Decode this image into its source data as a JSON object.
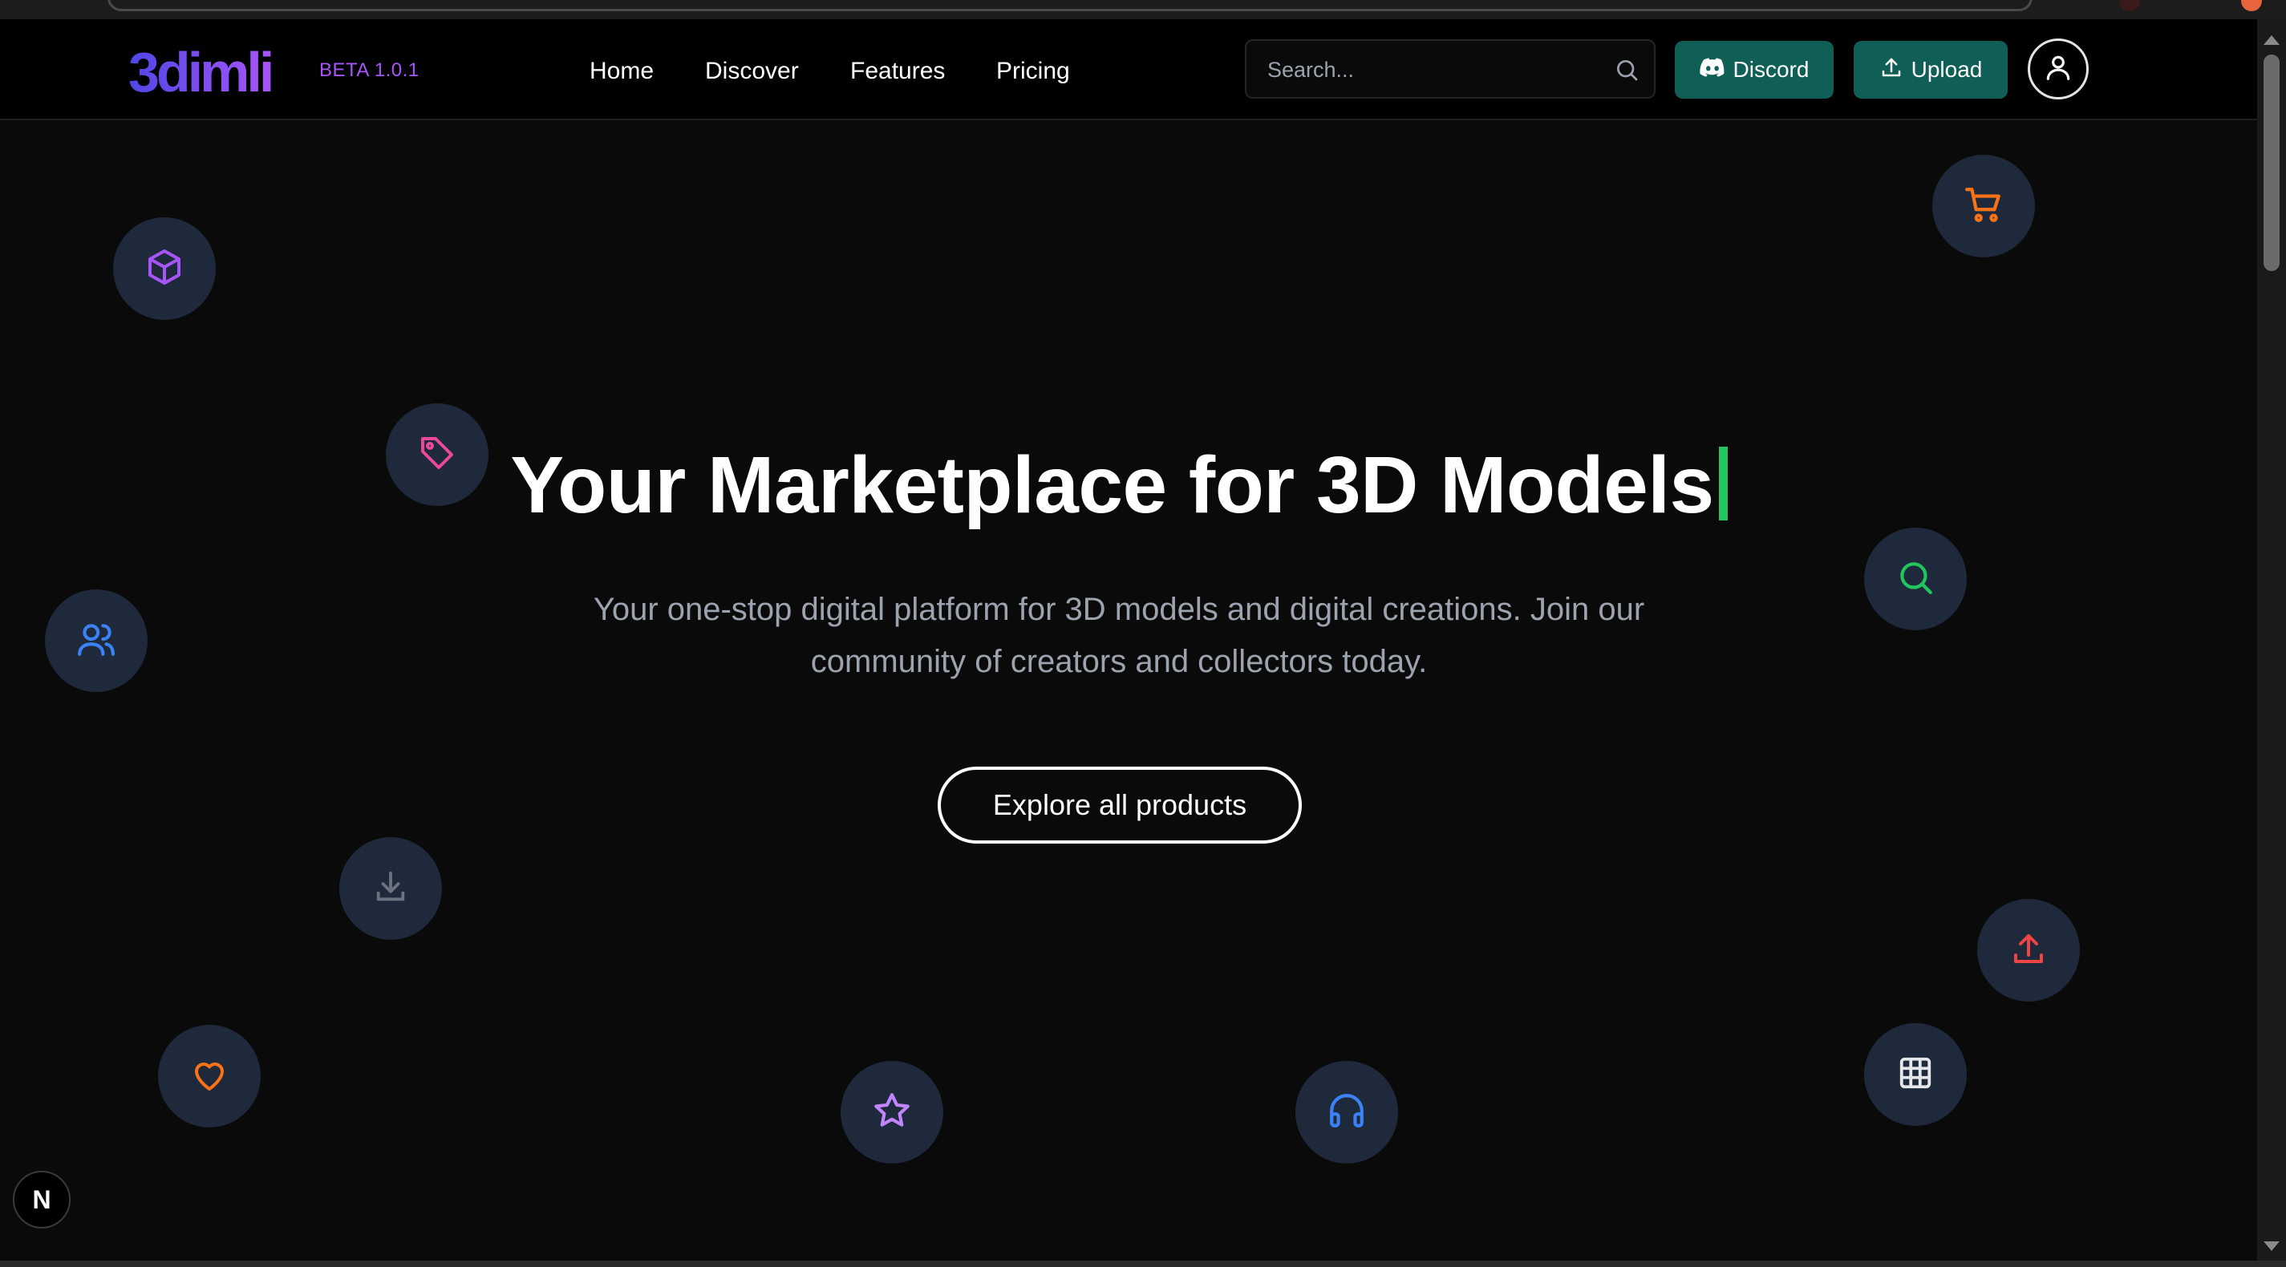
{
  "brand": {
    "logo_text": "3dimli",
    "version_badge": "BETA 1.0.1",
    "accent": "#7c3aed"
  },
  "nav": {
    "links": [
      "Home",
      "Discover",
      "Features",
      "Pricing"
    ]
  },
  "search": {
    "placeholder": "Search..."
  },
  "actions": {
    "discord_label": "Discord",
    "upload_label": "Upload",
    "button_color": "#0f5f57"
  },
  "hero": {
    "title": "Your Marketplace for 3D Models",
    "subtitle_line1": "Your one-stop digital platform for 3D models and digital creations. Join our",
    "subtitle_line2": "community of creators and collectors today.",
    "cta_label": "Explore all products",
    "cursor_color": "#22c55e"
  },
  "floating_icons": [
    {
      "icon": "cube-icon",
      "color": "#a855f7"
    },
    {
      "icon": "tag-icon",
      "color": "#ec4899"
    },
    {
      "icon": "users-icon",
      "color": "#3b82f6"
    },
    {
      "icon": "download-icon",
      "color": "#6b7280"
    },
    {
      "icon": "heart-icon",
      "color": "#f97316"
    },
    {
      "icon": "star-icon",
      "color": "#c084fc"
    },
    {
      "icon": "headphones-icon",
      "color": "#3b82f6"
    },
    {
      "icon": "cart-icon",
      "color": "#f97316"
    },
    {
      "icon": "search-icon",
      "color": "#22c55e"
    },
    {
      "icon": "upload-icon",
      "color": "#ef4444"
    },
    {
      "icon": "grid-icon",
      "color": "#e5e7eb"
    }
  ],
  "dev_badge": "N"
}
